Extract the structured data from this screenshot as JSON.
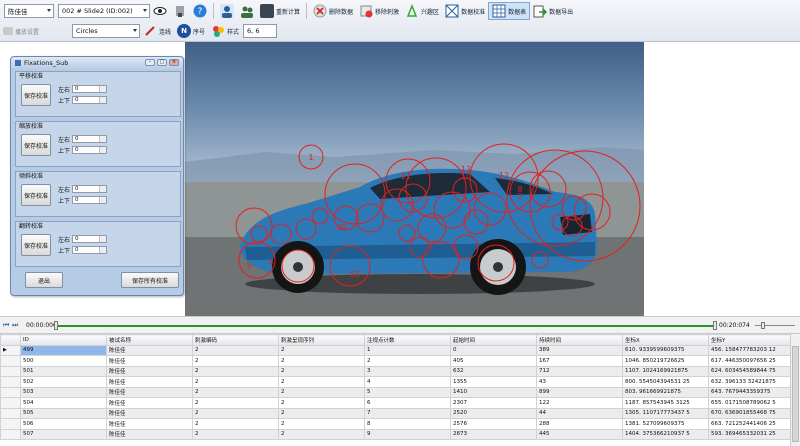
{
  "toolbar": {
    "subject": "陈佳佳",
    "slide": "002 # Slide2 (ID:002)",
    "recalc": "重新计算",
    "delete_data": "删除数据",
    "remove_stim": "移除刺激",
    "aoi": "兴趣区",
    "data_calib": "数据校准",
    "data_table": "数据表",
    "data_export": "数据导出",
    "playback_settings": "播放设置",
    "shape": "Circles",
    "connect": "连线",
    "seq": "序号",
    "seq_badge": "N",
    "style_label": "样式",
    "style_value": "6, 6"
  },
  "fixations": {
    "labels": [
      "1",
      "11",
      "13",
      "12",
      "8",
      "2",
      "30",
      "55",
      "10",
      "5",
      "4"
    ]
  },
  "subwin": {
    "title": "Fixations_Sub",
    "groups": [
      {
        "title": "平移校准",
        "btn": "保存校准",
        "l1": "左右",
        "v1": "0",
        "l2": "上下",
        "v2": "0"
      },
      {
        "title": "缩放校准",
        "btn": "保存校准",
        "l1": "左右",
        "v1": "0",
        "l2": "上下",
        "v2": "0"
      },
      {
        "title": "倾斜校准",
        "btn": "保存校准",
        "l1": "左右",
        "v1": "0",
        "l2": "上下",
        "v2": "0"
      },
      {
        "title": "翻转校准",
        "btn": "保存校准",
        "l1": "左右",
        "v1": "0",
        "l2": "上下",
        "v2": "0"
      }
    ],
    "exit": "退出",
    "save_all": "保存所有校准"
  },
  "timeline": {
    "start": "00:00:000",
    "end": "00:20:074"
  },
  "table": {
    "columns": [
      "ID",
      "被试名称",
      "刺激编码",
      "刺激呈现序列",
      "注视点计数",
      "起始时间",
      "持续时间",
      "坐标X",
      "坐标Y"
    ],
    "rows": [
      [
        "499",
        "陈佳佳",
        "2",
        "2",
        "1",
        "0",
        "389",
        "610. 9339599609375",
        "456. 158477783203 12"
      ],
      [
        "500",
        "陈佳佳",
        "2",
        "2",
        "2",
        "405",
        "167",
        "1046. 850219726625",
        "617. 446350097656 25"
      ],
      [
        "501",
        "陈佳佳",
        "2",
        "2",
        "3",
        "632",
        "712",
        "1107. 1024169921875",
        "624. 603454589844 75"
      ],
      [
        "502",
        "陈佳佳",
        "2",
        "2",
        "4",
        "1355",
        "43",
        "800. 554504394531 25",
        "632. 396133 32421875"
      ],
      [
        "503",
        "陈佳佳",
        "2",
        "2",
        "5",
        "1410",
        "899",
        "803. 961669921875",
        "643. 7679443359375"
      ],
      [
        "504",
        "陈佳佳",
        "2",
        "2",
        "6",
        "2307",
        "122",
        "1187. 857543945 3125",
        "655. 0171508789062 5"
      ],
      [
        "505",
        "陈佳佳",
        "2",
        "2",
        "7",
        "2520",
        "44",
        "1305. 110717773437 5",
        "670. 636901855468 75"
      ],
      [
        "506",
        "陈佳佳",
        "2",
        "2",
        "8",
        "2576",
        "288",
        "1381. 527099609375",
        "663. 721252441406 25"
      ],
      [
        "507",
        "陈佳佳",
        "2",
        "2",
        "9",
        "2873",
        "445",
        "1404. 375366210937 5",
        "593. 369465332031 25"
      ]
    ]
  },
  "colors": {
    "accent": "#2f8f2f",
    "fixation": "#e3211c",
    "window": "#b6cbe4"
  },
  "icons": [
    "eye-icon",
    "brush-icon",
    "help-icon",
    "person-icon",
    "people-icon",
    "calc-icon",
    "delete-icon",
    "remove-icon",
    "aoi-icon",
    "calib-icon",
    "table-icon",
    "export-icon"
  ]
}
